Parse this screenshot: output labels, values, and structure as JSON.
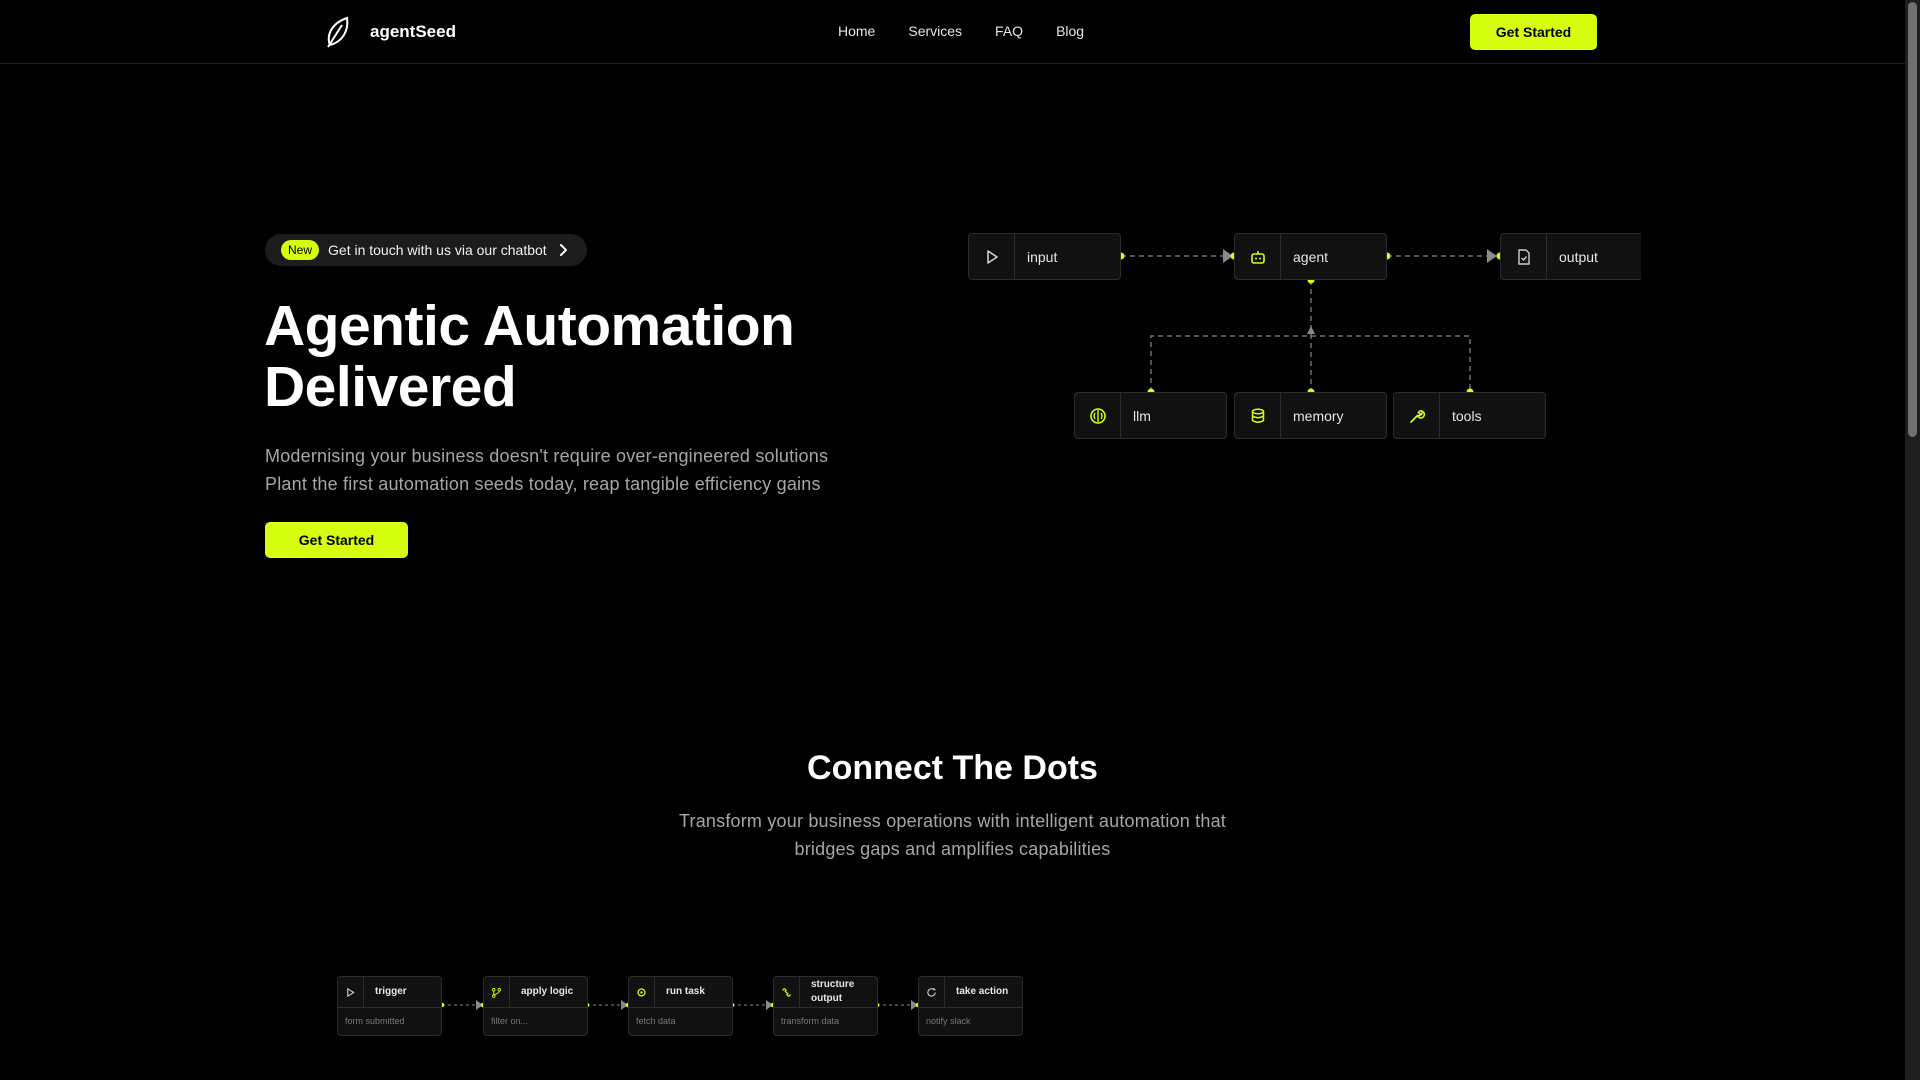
{
  "brand": {
    "name": "agentSeed"
  },
  "nav": {
    "items": [
      "Home",
      "Services",
      "FAQ",
      "Blog"
    ]
  },
  "header": {
    "cta_label": "Get Started"
  },
  "hero": {
    "badge": "New",
    "pill_text": "Get in touch with us via our chatbot",
    "title_line1": "Agentic Automation",
    "title_line2": "Delivered",
    "subtitle_line1": "Modernising your business doesn't require over-engineered solutions",
    "subtitle_line2": "Plant the first automation seeds today, reap tangible efficiency gains",
    "cta_label": "Get Started"
  },
  "diagram": {
    "nodes": {
      "input": {
        "label": "input",
        "icon": "play-icon"
      },
      "agent": {
        "label": "agent",
        "icon": "robot-icon"
      },
      "output": {
        "label": "output",
        "icon": "file-check-icon"
      },
      "llm": {
        "label": "llm",
        "icon": "brain-icon"
      },
      "memory": {
        "label": "memory",
        "icon": "database-icon"
      },
      "tools": {
        "label": "tools",
        "icon": "wrench-icon"
      }
    }
  },
  "section": {
    "title": "Connect The Dots",
    "subtitle_line1": "Transform your business operations with intelligent automation that",
    "subtitle_line2": "bridges gaps and amplifies capabilities"
  },
  "workflow": {
    "steps": [
      {
        "title": "trigger",
        "sub": "form submitted",
        "icon": "play-icon"
      },
      {
        "title": "apply logic",
        "sub": "filter on...",
        "icon": "branch-icon"
      },
      {
        "title": "run task",
        "sub": "fetch data",
        "icon": "cog-icon"
      },
      {
        "title": "structure output",
        "sub": "transform data",
        "icon": "link-icon"
      },
      {
        "title": "take action",
        "sub": "notify slack",
        "icon": "refresh-icon"
      }
    ]
  },
  "colors": {
    "accent": "#d6ff0f",
    "background": "#000000",
    "node_bg": "#111111",
    "node_border": "#2c2c2c",
    "muted_text": "#a6a6a6"
  }
}
